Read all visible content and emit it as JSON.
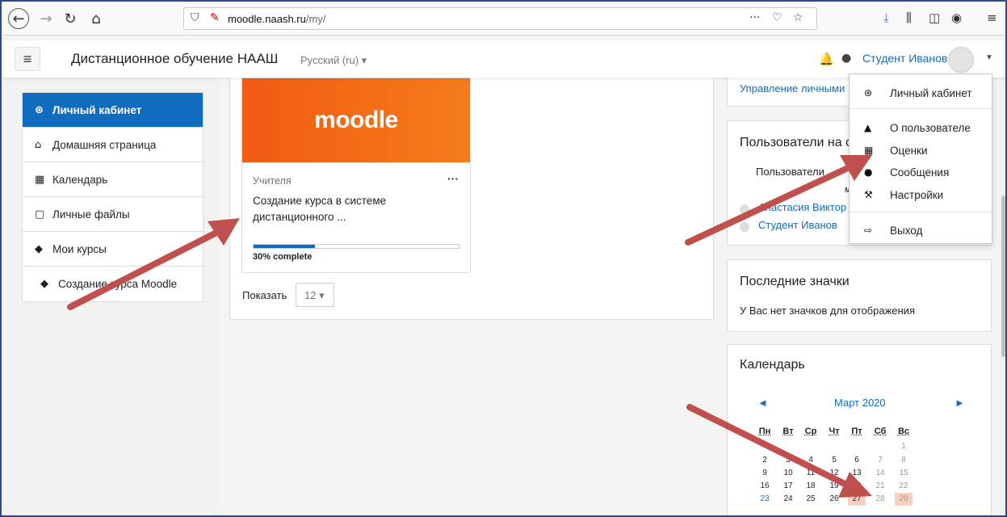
{
  "browser": {
    "url_host": "moodle.naash.ru",
    "url_path": "/my/"
  },
  "navbar": {
    "site_name": "Дистанционное обучение НААШ",
    "language": "Русский (ru) ▾",
    "user_name": "Студент Иванов"
  },
  "sidebar": {
    "items": [
      {
        "label": "Личный кабинет",
        "icon": "dashboard-icon",
        "glyph": "⊛"
      },
      {
        "label": "Домашняя страница",
        "icon": "home-icon",
        "glyph": "⌂"
      },
      {
        "label": "Календарь",
        "icon": "calendar-icon",
        "glyph": "▦"
      },
      {
        "label": "Личные файлы",
        "icon": "file-icon",
        "glyph": "▢"
      },
      {
        "label": "Мои курсы",
        "icon": "graduation-cap-icon",
        "glyph": "◆"
      },
      {
        "label": "Создание курса Moodle",
        "icon": "graduation-cap-icon",
        "glyph": "◆"
      }
    ]
  },
  "course": {
    "image_logo": "moodle",
    "category": "Учителя",
    "name": "Создание курса в системе дистанционного ...",
    "progress_percent": 30,
    "progress_label": "30% complete",
    "menu": "···"
  },
  "paging": {
    "show_label": "Показать",
    "show_value": "12 ▾"
  },
  "blocks": {
    "manage_link": "Управление личными",
    "online": {
      "title": "Пользователи на с",
      "text": "Пользователи",
      "text2": "м",
      "users": [
        "Анастасия Виктор",
        "Студент Иванов"
      ]
    },
    "badges": {
      "title": "Последние значки",
      "empty": "У Вас нет значков для отображения"
    },
    "calendar": {
      "title": "Календарь",
      "month": "Март 2020",
      "prev": "◄",
      "next": "►",
      "weekdays": [
        "Пн",
        "Вт",
        "Ср",
        "Чт",
        "Пт",
        "Сб",
        "Вс"
      ],
      "weeks": [
        [
          "",
          "",
          "",
          "",
          "",
          "",
          "1"
        ],
        [
          "2",
          "3",
          "4",
          "5",
          "6",
          "7",
          "8"
        ],
        [
          "9",
          "10",
          "11",
          "12",
          "13",
          "14",
          "15"
        ],
        [
          "16",
          "17",
          "18",
          "19",
          "20",
          "21",
          "22"
        ],
        [
          "23",
          "24",
          "25",
          "26",
          "27",
          "28",
          "29"
        ]
      ],
      "event_days": [
        "27",
        "29"
      ],
      "link_days": [
        "23"
      ]
    }
  },
  "user_menu": {
    "items": [
      {
        "label": "Личный кабинет",
        "icon": "dashboard-icon",
        "glyph": "⊛"
      },
      {
        "label": "О пользователе",
        "icon": "user-icon",
        "glyph": "▲"
      },
      {
        "label": "Оценки",
        "icon": "table-icon",
        "glyph": "▦"
      },
      {
        "label": "Сообщения",
        "icon": "comment-icon",
        "glyph": "●"
      },
      {
        "label": "Настройки",
        "icon": "wrench-icon",
        "glyph": "⚒"
      },
      {
        "label": "Выход",
        "icon": "sign-out-icon",
        "glyph": "⇨"
      }
    ]
  },
  "colors": {
    "accent": "#0f6cbf",
    "annotation_arrow": "#c0504d"
  }
}
